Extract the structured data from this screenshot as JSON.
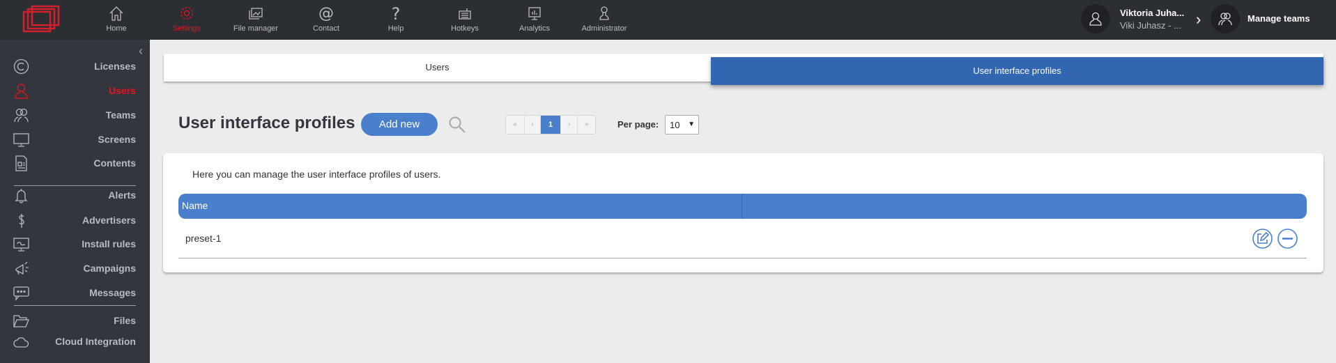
{
  "colors": {
    "topbar": "#2b2e33",
    "sidebar": "#33363c",
    "accent": "#4a7fcb",
    "active_tab": "#3366b0",
    "active_red": "#e8141c"
  },
  "topnav": [
    {
      "label": "Home",
      "icon": "home-icon"
    },
    {
      "label": "Settings",
      "icon": "gear-icon",
      "active": true
    },
    {
      "label": "File manager",
      "icon": "images-icon"
    },
    {
      "label": "Contact",
      "icon": "at-icon"
    },
    {
      "label": "Help",
      "icon": "question-icon"
    },
    {
      "label": "Hotkeys",
      "icon": "keyboard-icon"
    },
    {
      "label": "Analytics",
      "icon": "analytics-icon"
    },
    {
      "label": "Administrator",
      "icon": "admin-icon"
    }
  ],
  "user": {
    "name": "Viktoria Juha...",
    "sub": "Viki Juhasz - ...",
    "manage_teams": "Manage teams"
  },
  "sidebar": {
    "items": [
      {
        "label": "Licenses",
        "icon": "copyright-icon"
      },
      {
        "label": "Users",
        "icon": "user-icon",
        "active": true
      },
      {
        "label": "Teams",
        "icon": "team-icon"
      },
      {
        "label": "Screens",
        "icon": "monitor-icon"
      },
      {
        "label": "Contents",
        "icon": "document-icon"
      },
      {
        "label": "Alerts",
        "icon": "bell-icon"
      },
      {
        "label": "Advertisers",
        "icon": "dollar-icon"
      },
      {
        "label": "Install rules",
        "icon": "install-rules-icon"
      },
      {
        "label": "Campaigns",
        "icon": "megaphone-icon"
      },
      {
        "label": "Messages",
        "icon": "message-icon"
      },
      {
        "label": "Files",
        "icon": "folder-icon"
      },
      {
        "label": "Cloud Integration",
        "icon": "cloud-icon"
      }
    ]
  },
  "tabs": [
    {
      "label": "Users"
    },
    {
      "label": "User interface profiles",
      "active": true
    }
  ],
  "page": {
    "title": "User interface profiles",
    "add_new": "Add new",
    "description": "Here you can manage the user interface profiles of users."
  },
  "pagination": {
    "first": "«",
    "prev": "‹",
    "current": "1",
    "next": "›",
    "last": "»",
    "per_page_label": "Per page:",
    "per_page_value": "10"
  },
  "table": {
    "columns": [
      "Name",
      ""
    ],
    "rows": [
      {
        "name": "preset-1"
      }
    ]
  }
}
